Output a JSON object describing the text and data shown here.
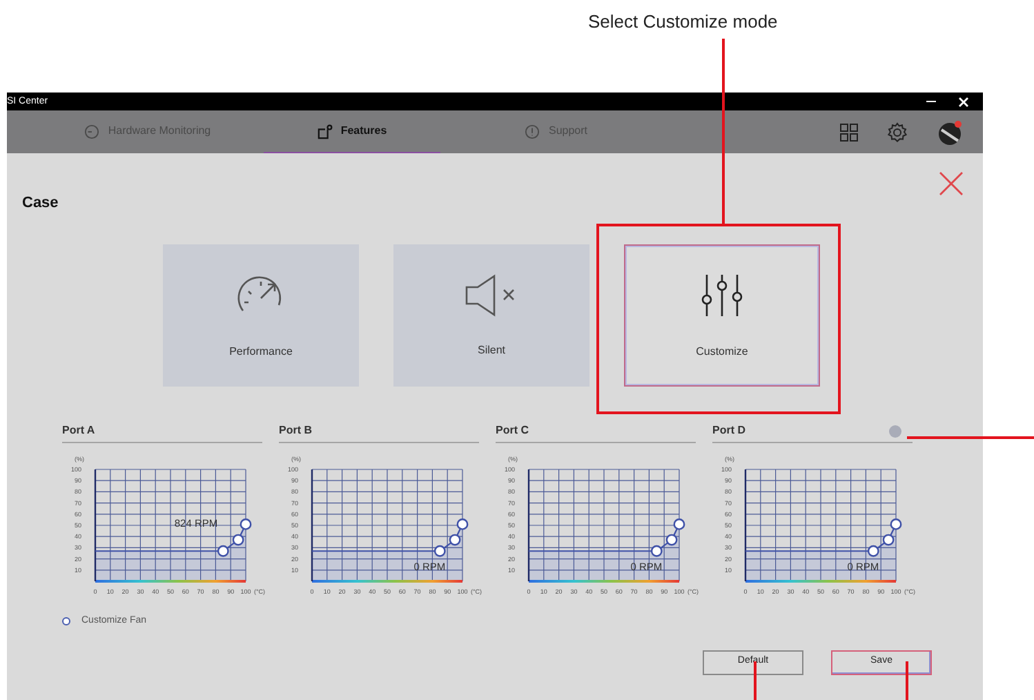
{
  "callout": {
    "text": "Select Customize mode"
  },
  "window": {
    "title": "SI Center"
  },
  "tabs": [
    {
      "label": "Hardware Monitoring",
      "kind": "monitor",
      "selected": false
    },
    {
      "label": "Features",
      "kind": "features",
      "selected": true
    },
    {
      "label": "Support",
      "kind": "support",
      "selected": false
    }
  ],
  "section_title": "Case",
  "modes": [
    {
      "label": "Performance",
      "kind": "performance",
      "selected": false
    },
    {
      "label": "Silent",
      "kind": "silent",
      "selected": false
    },
    {
      "label": "Customize",
      "kind": "customize",
      "selected": true
    }
  ],
  "ports": [
    {
      "title": "Port A",
      "rpm": "824 RPM",
      "rpm_above": true,
      "help_icon": false,
      "chart_data": {
        "type": "line",
        "grid": true,
        "xlabel": "(°C)",
        "ylabel": "(%)",
        "x": [
          0,
          85,
          95,
          100
        ],
        "series": [
          {
            "color": "#3f51a8",
            "values": [
              27,
              27,
              37,
              51
            ]
          }
        ],
        "xlim": [
          0,
          100
        ],
        "ylim": [
          0,
          100
        ],
        "xticks": [
          0,
          10,
          20,
          30,
          40,
          50,
          60,
          70,
          80,
          90,
          100
        ],
        "yticks": [
          10,
          20,
          30,
          40,
          50,
          60,
          70,
          80,
          90,
          100
        ]
      }
    },
    {
      "title": "Port B",
      "rpm": "0 RPM",
      "rpm_above": false,
      "help_icon": false,
      "chart_data": {
        "type": "line",
        "grid": true,
        "xlabel": "(°C)",
        "ylabel": "(%)",
        "x": [
          0,
          85,
          95,
          100
        ],
        "series": [
          {
            "color": "#3f51a8",
            "values": [
              27,
              27,
              37,
              51
            ]
          }
        ],
        "xlim": [
          0,
          100
        ],
        "ylim": [
          0,
          100
        ],
        "xticks": [
          0,
          10,
          20,
          30,
          40,
          50,
          60,
          70,
          80,
          90,
          100
        ],
        "yticks": [
          10,
          20,
          30,
          40,
          50,
          60,
          70,
          80,
          90,
          100
        ]
      }
    },
    {
      "title": "Port C",
      "rpm": "0 RPM",
      "rpm_above": false,
      "help_icon": false,
      "chart_data": {
        "type": "line",
        "grid": true,
        "xlabel": "(°C)",
        "ylabel": "(%)",
        "x": [
          0,
          85,
          95,
          100
        ],
        "series": [
          {
            "color": "#3f51a8",
            "values": [
              27,
              27,
              37,
              51
            ]
          }
        ],
        "xlim": [
          0,
          100
        ],
        "ylim": [
          0,
          100
        ],
        "xticks": [
          0,
          10,
          20,
          30,
          40,
          50,
          60,
          70,
          80,
          90,
          100
        ],
        "yticks": [
          10,
          20,
          30,
          40,
          50,
          60,
          70,
          80,
          90,
          100
        ]
      }
    },
    {
      "title": "Port D",
      "rpm": "0 RPM",
      "rpm_above": false,
      "help_icon": true,
      "chart_data": {
        "type": "line",
        "grid": true,
        "xlabel": "(°C)",
        "ylabel": "(%)",
        "x": [
          0,
          85,
          95,
          100
        ],
        "series": [
          {
            "color": "#3f51a8",
            "values": [
              27,
              27,
              37,
              51
            ]
          }
        ],
        "xlim": [
          0,
          100
        ],
        "ylim": [
          0,
          100
        ],
        "xticks": [
          0,
          10,
          20,
          30,
          40,
          50,
          60,
          70,
          80,
          90,
          100
        ],
        "yticks": [
          10,
          20,
          30,
          40,
          50,
          60,
          70,
          80,
          90,
          100
        ]
      }
    }
  ],
  "legend": "Customize Fan",
  "buttons": [
    {
      "label": "Default",
      "kind": "default"
    },
    {
      "label": "Save",
      "kind": "save"
    }
  ]
}
